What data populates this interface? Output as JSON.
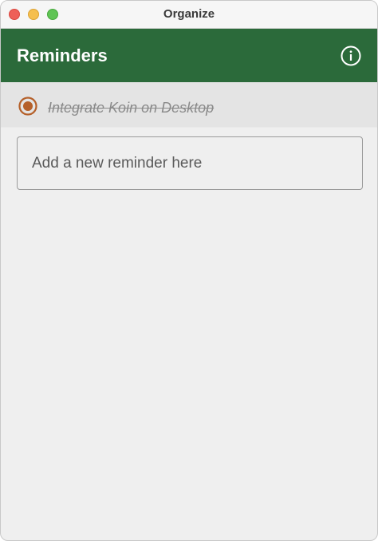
{
  "window": {
    "title": "Organize"
  },
  "appbar": {
    "title": "Reminders",
    "info_icon": "info-circle-icon"
  },
  "reminders": [
    {
      "text": "Integrate Koin on Desktop",
      "completed": true,
      "icon": "radio-selected-icon"
    }
  ],
  "new_reminder": {
    "placeholder": "Add a new reminder here",
    "value": ""
  },
  "colors": {
    "appbar": "#2b6a3a",
    "radio_accent": "#b5602a",
    "background": "#efefef"
  }
}
